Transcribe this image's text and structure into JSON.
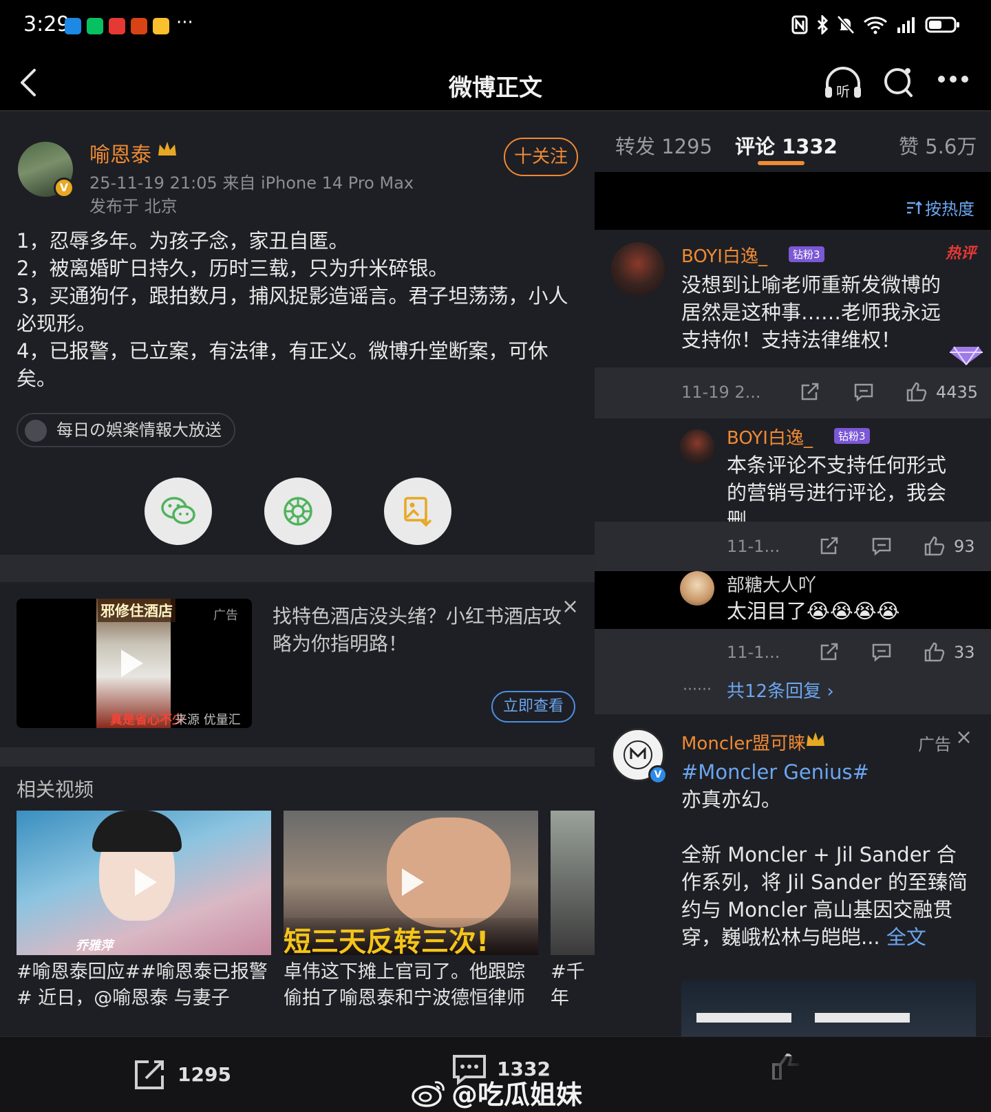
{
  "status_bar": {
    "time": "3:29",
    "more": "···"
  },
  "nav": {
    "title": "微博正文"
  },
  "post": {
    "author": "喻恩泰",
    "verified_mark": "V",
    "follow_label": "十关注",
    "meta": "25-11-19 21:05  来自 iPhone 14 Pro Max",
    "location": "发布于 北京",
    "lines": [
      "1，忍辱多年。为孩子念，家丑自匿。",
      "2，被离婚旷日持久，历时三载，只为升米碎银。",
      "3，买通狗仔，跟拍数月，捕风捉影造谣言。君子坦荡荡，小人必现形。",
      "4，已报警，已立案，有法律，有正义。微博升堂断案，可休矣。"
    ],
    "topic_chip": "每日の娯楽情報大放送"
  },
  "ad": {
    "thumb_title": "邪修住酒店",
    "thumb_bottom": "真是省心不少",
    "tag": "广告",
    "source": "来源 优量汇",
    "text": "找特色酒店没头绪？小红书酒店攻略为你指明路！",
    "close": "×",
    "cta": "立即查看"
  },
  "related": {
    "title": "相关视频",
    "videos": [
      {
        "caption": "#喻恩泰回应##喻恩泰已报警# 近日，@喻恩泰 与妻子",
        "overlay": "乔雅萍"
      },
      {
        "caption": "卓伟这下摊上官司了。他跟踪偷拍了喻恩泰和宁波德恒律师",
        "overlay": "短三天反转三次!"
      },
      {
        "caption": "#千年KTV#",
        "overlay": ""
      }
    ]
  },
  "tabs": {
    "repost": "转发 1295",
    "comment": "评论 1332",
    "like": "赞 5.6万"
  },
  "sort_label": "按热度",
  "comments": [
    {
      "name": "BOYI白逸_",
      "badge": "钻粉3",
      "hot": "热评",
      "text": "没想到让喻老师重新发微博的居然是这种事……老师我永远支持你！支持法律维权！",
      "time": "11-19 2...",
      "likes": "4435"
    },
    {
      "name": "BOYI白逸_",
      "badge": "钻粉3",
      "text": "本条评论不支持任何形式的营销号进行评论，我会删。",
      "time": "11-1...",
      "likes": "93"
    },
    {
      "name": "部糖大人吖",
      "text": "太泪目了😭😭😭😭",
      "time": "11-1...",
      "likes": "33"
    }
  ],
  "reply_summary": {
    "dots": "······",
    "link": "共12条回复 ›"
  },
  "ad_comment": {
    "name": "Moncler盟可睐",
    "tag": "广告",
    "close": "×",
    "hashtag": "#Moncler Genius#",
    "line1": "亦真亦幻。",
    "body": "全新 Moncler + Jil Sander 合作系列，将 Jil Sander 的至臻简约与 Moncler 高山基因交融贯穿，巍峨松林与皑皑...",
    "more": "全文"
  },
  "bottom_bar": {
    "repost_count": "1295",
    "comment_count": "1332"
  },
  "watermark": "@吃瓜姐妹",
  "colors": {
    "accent": "#f08a33",
    "link": "#6ba6f0",
    "bg": "#1e1f24"
  }
}
